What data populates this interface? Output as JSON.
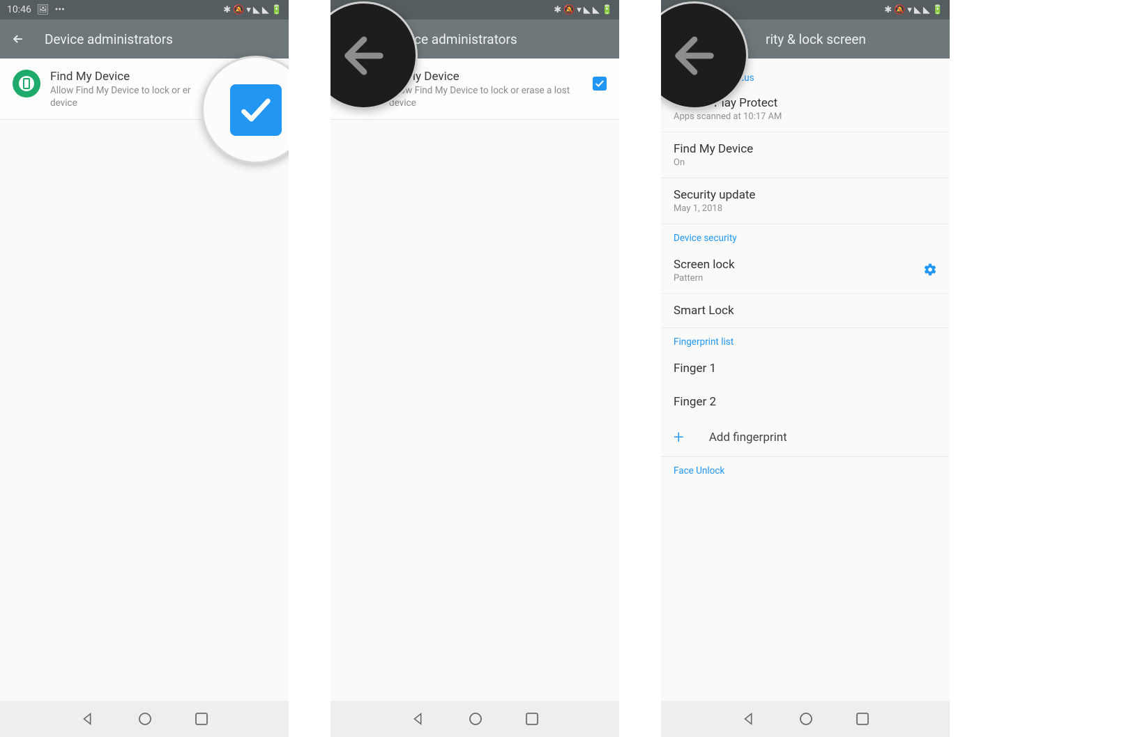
{
  "status_bar": {
    "time": "10:46",
    "icons_text": "✱ 🔕 ▼ ◥ ◥ 🔋"
  },
  "screen1": {
    "title": "Device administrators",
    "item": {
      "title": "Find My Device",
      "sub_truncated": "Allow Find My Device to lock or er\ndevice"
    }
  },
  "screen2": {
    "title_partial": "ce administrators",
    "item": {
      "title": "nd My Device",
      "sub": "Allow Find My Device to lock or erase a lost device"
    }
  },
  "screen3": {
    "title_partial": "rity & lock screen",
    "status_partial": "status",
    "google_play": {
      "title": "Google Play Protect",
      "sub": "Apps scanned at 10:17 AM"
    },
    "find_my_device": {
      "title": "Find My Device",
      "sub": "On"
    },
    "security_update": {
      "title": "Security update",
      "sub": "May 1, 2018"
    },
    "device_security_header": "Device security",
    "screen_lock": {
      "title": "Screen lock",
      "sub": "Pattern"
    },
    "smart_lock": {
      "title": "Smart Lock"
    },
    "fingerprint_header": "Fingerprint list",
    "finger1": "Finger 1",
    "finger2": "Finger 2",
    "add_fingerprint": "Add fingerprint",
    "face_unlock_header": "Face Unlock"
  }
}
